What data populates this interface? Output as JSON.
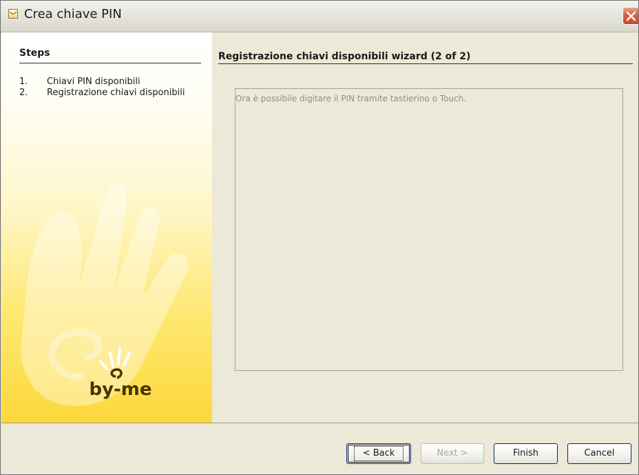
{
  "window": {
    "title": "Crea chiave PIN"
  },
  "icons": {
    "title_icon": "mail-envelope-icon",
    "close": "close-x-icon"
  },
  "sidebar": {
    "heading": "Steps",
    "steps": [
      {
        "num": "1.",
        "label": "Chiavi PIN disponibili"
      },
      {
        "num": "2.",
        "label": "Registrazione chiavi disponibili"
      }
    ],
    "logo_text": "by-me"
  },
  "content": {
    "title": "Registrazione chiavi disponibili wizard (2 of 2)",
    "message": "Ora è possibile digitare il PIN tramite tastierino o Touch."
  },
  "buttons": {
    "back": "< Back",
    "next": "Next >",
    "finish": "Finish",
    "cancel": "Cancel"
  },
  "colors": {
    "panel_gradient_top": "#ffffff",
    "panel_gradient_bottom": "#fcd83a",
    "close_button": "#d9603f",
    "window_bg": "#ece9d8"
  }
}
